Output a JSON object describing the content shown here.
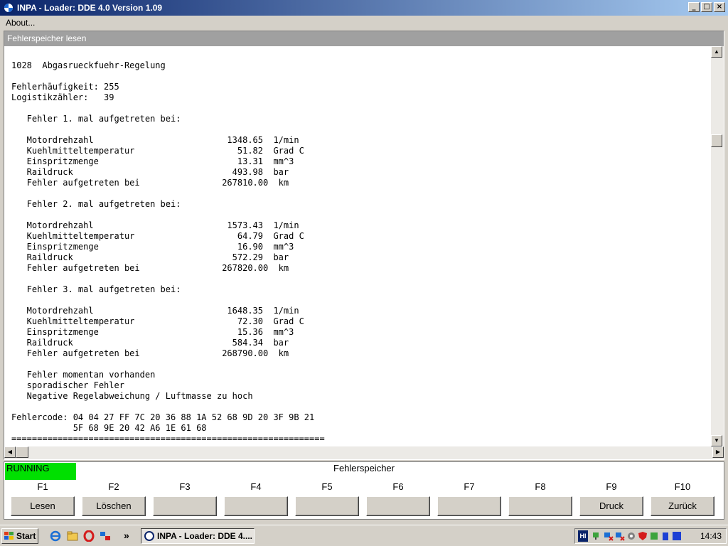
{
  "window": {
    "title": "INPA - Loader: DDE 4.0 Version 1.09"
  },
  "menu": {
    "items": [
      "About..."
    ]
  },
  "panel": {
    "title": "Fehlerspeicher lesen",
    "lines": [
      "1028  Abgasrueckfuehr-Regelung",
      "",
      "Fehlerhäufigkeit: 255",
      "Logistikzähler:   39",
      "",
      "   Fehler 1. mal aufgetreten bei:",
      "",
      "   Motordrehzahl                          1348.65  1/min",
      "   Kuehlmitteltemperatur                    51.82  Grad C",
      "   Einspritzmenge                           13.31  mm^3",
      "   Raildruck                               493.98  bar",
      "   Fehler aufgetreten bei                267810.00  km",
      "",
      "   Fehler 2. mal aufgetreten bei:",
      "",
      "   Motordrehzahl                          1573.43  1/min",
      "   Kuehlmitteltemperatur                    64.79  Grad C",
      "   Einspritzmenge                           16.90  mm^3",
      "   Raildruck                               572.29  bar",
      "   Fehler aufgetreten bei                267820.00  km",
      "",
      "   Fehler 3. mal aufgetreten bei:",
      "",
      "   Motordrehzahl                          1648.35  1/min",
      "   Kuehlmitteltemperatur                    72.30  Grad C",
      "   Einspritzmenge                           15.36  mm^3",
      "   Raildruck                               584.34  bar",
      "   Fehler aufgetreten bei                268790.00  km",
      "",
      "   Fehler momentan vorhanden",
      "   sporadischer Fehler",
      "   Negative Regelabweichung / Luftmasse zu hoch",
      "",
      "Fehlercode: 04 04 27 FF 7C 20 36 88 1A 52 68 9D 20 3F 9B 21",
      "            5F 68 9E 20 42 A6 1E 61 68",
      "============================================================="
    ]
  },
  "status": {
    "running": "RUNNING",
    "screen_title": "Fehlerspeicher",
    "running_color": "#00e000"
  },
  "fkeys": [
    {
      "key": "F1",
      "label": "Lesen"
    },
    {
      "key": "F2",
      "label": "Löschen"
    },
    {
      "key": "F3",
      "label": ""
    },
    {
      "key": "F4",
      "label": ""
    },
    {
      "key": "F5",
      "label": ""
    },
    {
      "key": "F6",
      "label": ""
    },
    {
      "key": "F7",
      "label": ""
    },
    {
      "key": "F8",
      "label": ""
    },
    {
      "key": "F9",
      "label": "Druck"
    },
    {
      "key": "F10",
      "label": "Zurück"
    }
  ],
  "taskbar": {
    "start_label": "Start",
    "task_item": "INPA - Loader:  DDE 4....",
    "quicklaunch_more": "»",
    "clock": "14:43",
    "tray_lang": "HI"
  }
}
